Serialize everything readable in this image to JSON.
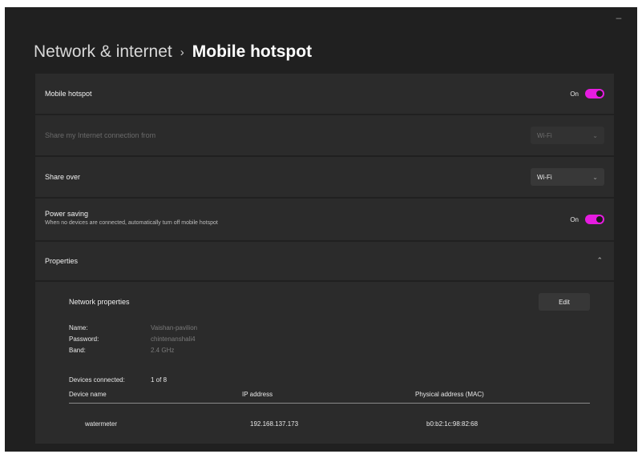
{
  "window": {
    "minimize_glyph": "–"
  },
  "breadcrumb": {
    "parent": "Network & internet",
    "separator": "›",
    "current": "Mobile hotspot"
  },
  "settings": {
    "mobile_hotspot": {
      "label": "Mobile hotspot",
      "state": "On"
    },
    "share_from": {
      "label": "Share my Internet connection from",
      "value": "Wi-Fi"
    },
    "share_over": {
      "label": "Share over",
      "value": "Wi-Fi"
    },
    "power_saving": {
      "label": "Power saving",
      "description": "When no devices are connected, automatically turn off mobile hotspot",
      "state": "On"
    },
    "properties": {
      "label": "Properties"
    }
  },
  "network_properties": {
    "title": "Network properties",
    "edit_label": "Edit",
    "fields": [
      {
        "label": "Name:",
        "value": "Vaishan-pavilion"
      },
      {
        "label": "Password:",
        "value": "chintenanshali4"
      },
      {
        "label": "Band:",
        "value": "2.4 GHz"
      }
    ],
    "devices_connected_label": "Devices connected:",
    "devices_connected_value": "1 of 8",
    "table": {
      "columns": [
        "Device name",
        "IP address",
        "Physical address (MAC)"
      ],
      "rows": [
        [
          "watermeter",
          "192.168.137.173",
          "b0:b2:1c:98:82:68"
        ]
      ]
    }
  },
  "icons": {
    "chevron_down": "chevron-down-icon",
    "chevron_up": "chevron-up-icon"
  },
  "colors": {
    "accent": "#e61ce0",
    "window_bg": "#202020",
    "card_bg": "#2b2b2b"
  }
}
